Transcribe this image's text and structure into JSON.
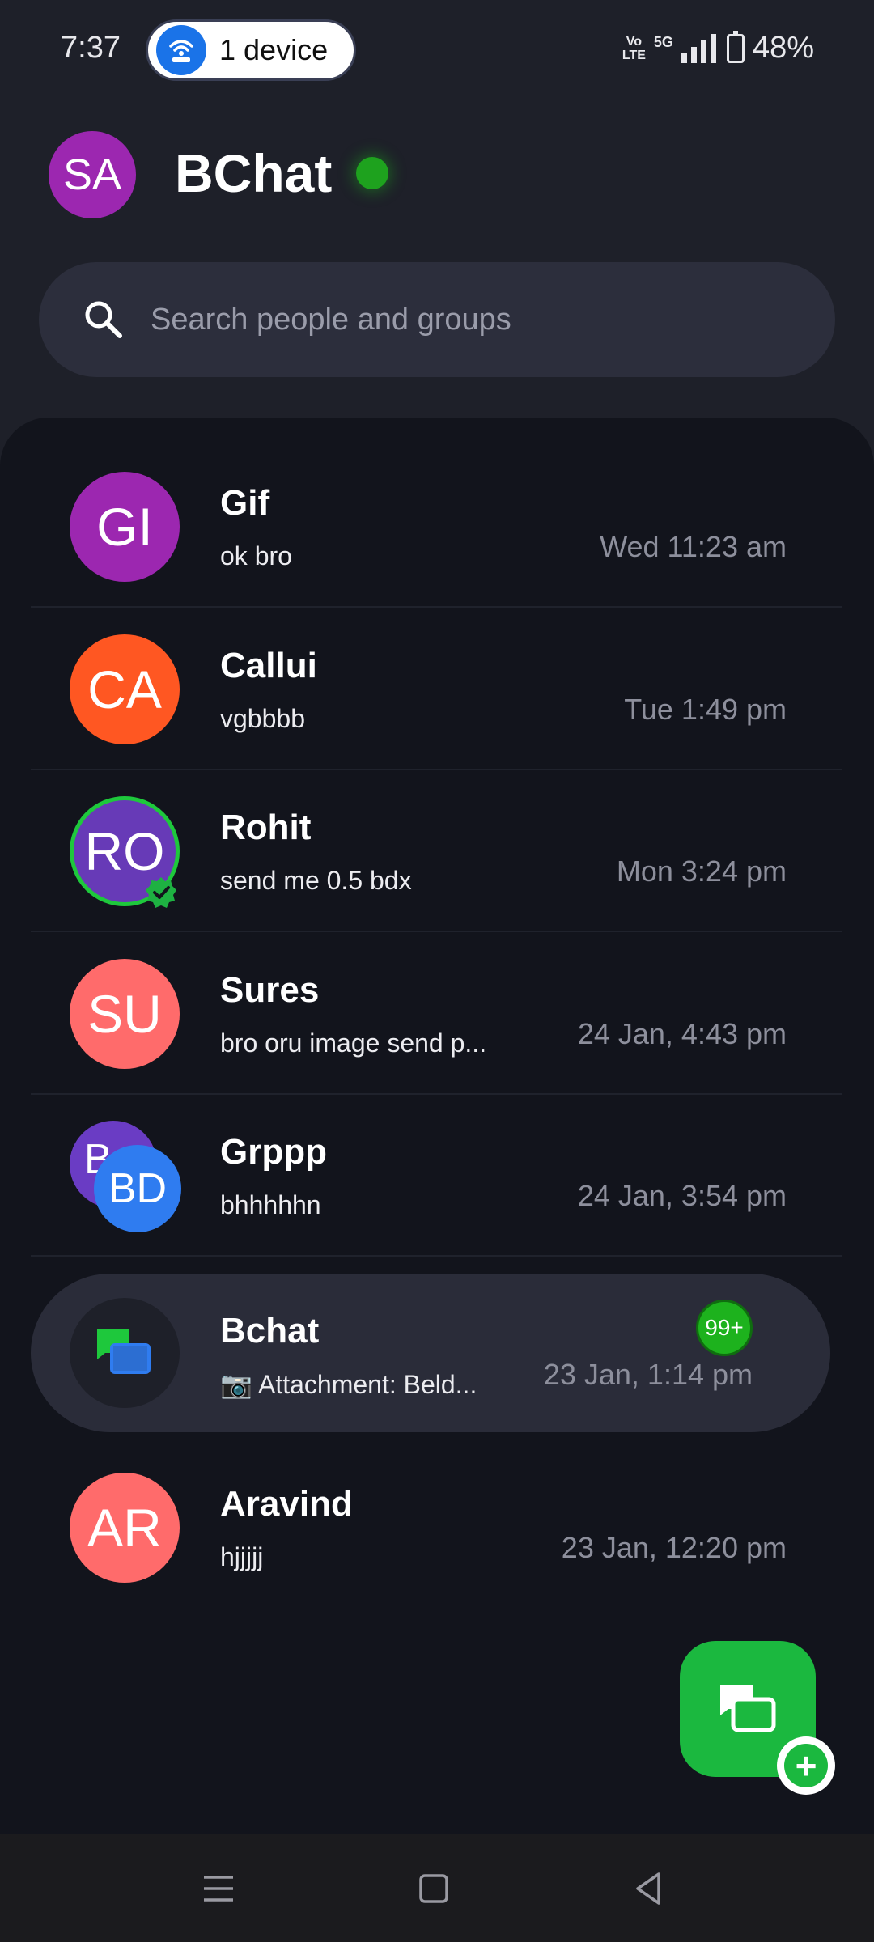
{
  "status_bar": {
    "time": "7:37",
    "hotspot_label": "1 device",
    "volte_top": "Vo",
    "volte_bottom": "LTE",
    "network": "5G",
    "battery": "48%"
  },
  "header": {
    "avatar_initials": "SA",
    "title": "BChat",
    "online_color": "#1ea21e"
  },
  "search": {
    "placeholder": "Search people and groups"
  },
  "chats": [
    {
      "initials": "GI",
      "name": "Gif",
      "message": "ok bro",
      "time": "Wed 11:23 am",
      "color": "#9c27b0"
    },
    {
      "initials": "CA",
      "name": "Callui",
      "message": "vgbbbb",
      "time": "Tue 1:49 pm",
      "color": "#ff5722"
    },
    {
      "initials": "RO",
      "name": "Rohit",
      "message": "send me 0.5 bdx",
      "time": "Mon 3:24 pm",
      "color": "#673ab7",
      "verified": true
    },
    {
      "initials": "SU",
      "name": "Sures",
      "message": "bro oru image send p...",
      "time": "24 Jan, 4:43 pm",
      "color": "#ff6b6b"
    },
    {
      "initials_back": "B",
      "initials": "BD",
      "name": "Grppp",
      "message": "bhhhhhn",
      "time": "24 Jan, 3:54 pm",
      "color": "#2f7cf0"
    },
    {
      "name": "Bchat",
      "message": "📷 Attachment: Beld...",
      "time": "23 Jan, 1:14 pm",
      "unread": "99+"
    },
    {
      "initials": "AR",
      "name": "Aravind",
      "message": "hjjjjj",
      "time": "23 Jan, 12:20 pm",
      "color": "#ff6b6b"
    }
  ],
  "fab": {
    "icon": "new-chat-icon",
    "color": "#1bb83f"
  },
  "nav": {
    "menu": "menu-icon",
    "home": "home-icon",
    "back": "back-icon"
  }
}
